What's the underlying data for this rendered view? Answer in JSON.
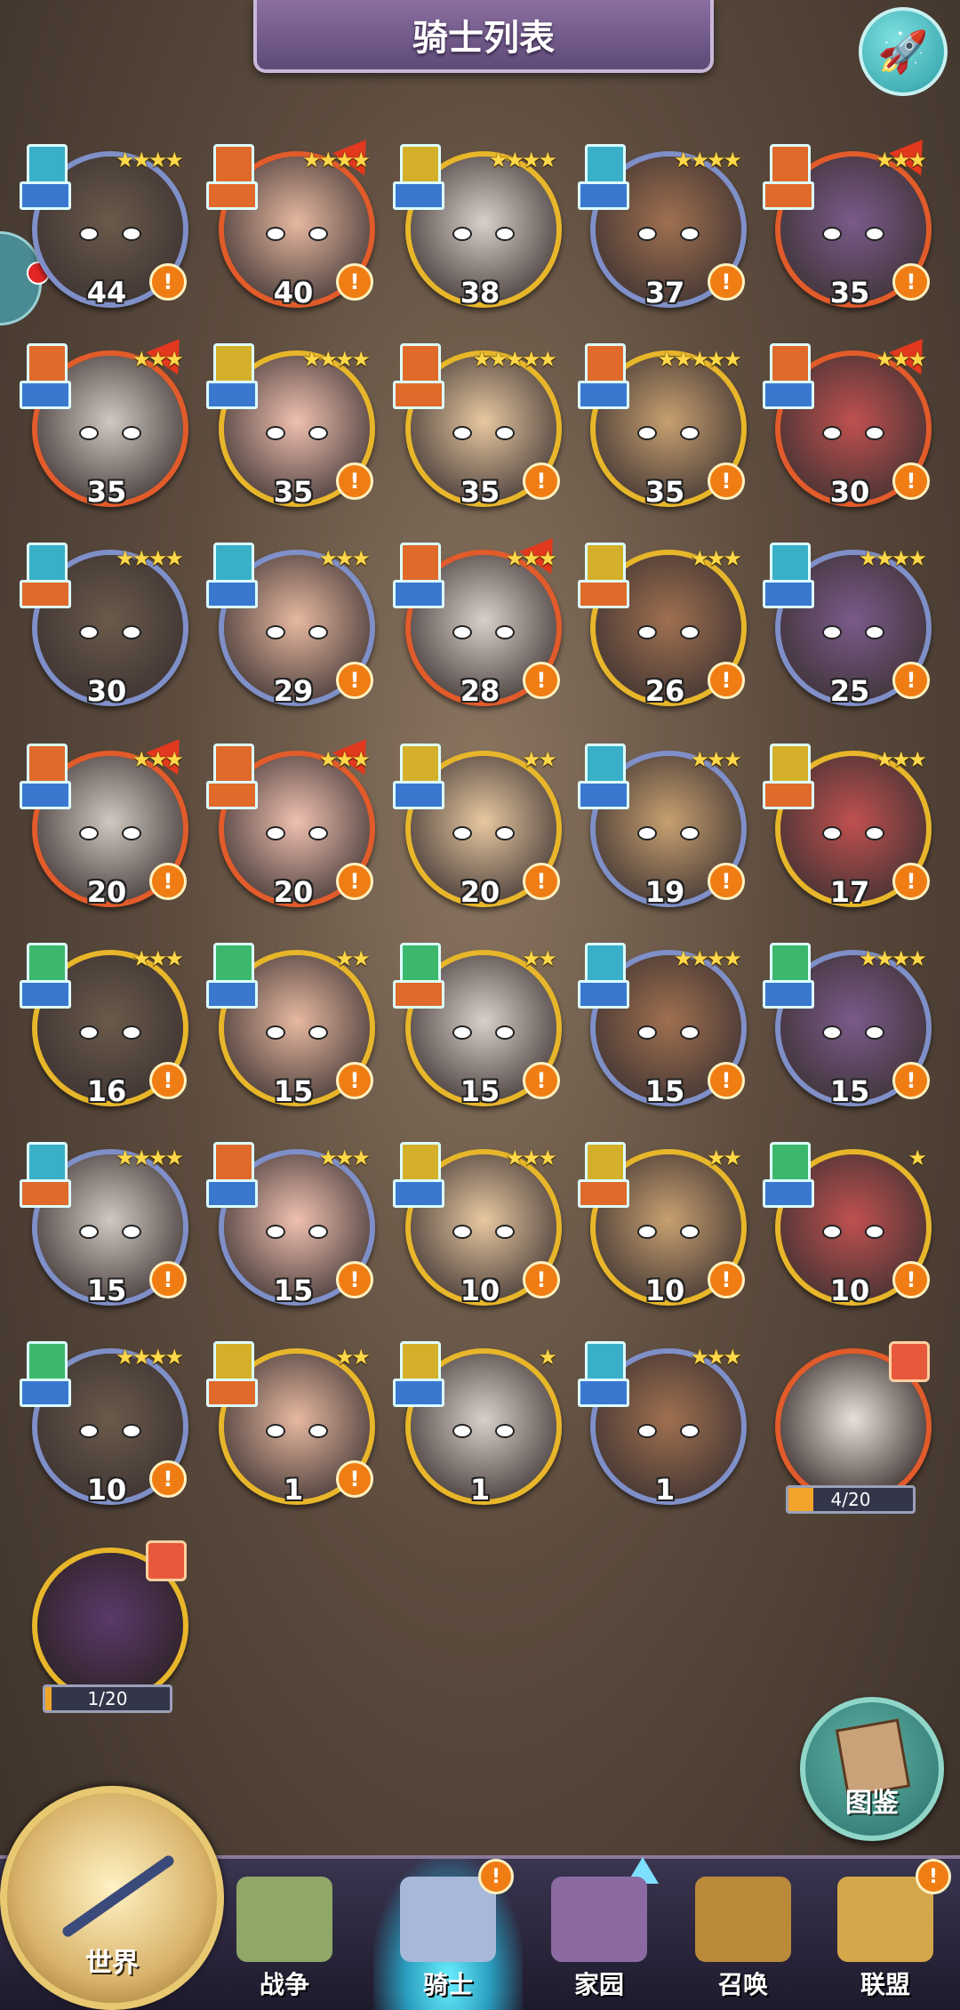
{
  "header": {
    "title": "骑士列表"
  },
  "knights": [
    {
      "level": "44",
      "stars": "★★★★",
      "rarity": "blue",
      "class": "cyan",
      "arrow": false,
      "alert": true
    },
    {
      "level": "40",
      "stars": "★★★★",
      "rarity": "red",
      "class": "orange",
      "arrow": true,
      "alert": true
    },
    {
      "level": "38",
      "stars": "★★★★",
      "rarity": "gold",
      "class": "yellow",
      "arrow": false,
      "alert": false
    },
    {
      "level": "37",
      "stars": "★★★★",
      "rarity": "blue",
      "class": "cyan",
      "arrow": false,
      "alert": true
    },
    {
      "level": "35",
      "stars": "★★★",
      "rarity": "red",
      "class": "orange",
      "arrow": true,
      "alert": true
    },
    {
      "level": "35",
      "stars": "★★★",
      "rarity": "red",
      "class": "orange",
      "arrow": true,
      "alert": false
    },
    {
      "level": "35",
      "stars": "★★★★",
      "rarity": "gold",
      "class": "yellow",
      "arrow": false,
      "alert": true
    },
    {
      "level": "35",
      "stars": "★★★★★",
      "rarity": "gold",
      "class": "orange",
      "arrow": false,
      "alert": true
    },
    {
      "level": "35",
      "stars": "★★★★★",
      "rarity": "gold",
      "class": "orange",
      "arrow": false,
      "alert": true
    },
    {
      "level": "30",
      "stars": "★★★",
      "rarity": "red",
      "class": "orange",
      "arrow": true,
      "alert": true
    },
    {
      "level": "30",
      "stars": "★★★★",
      "rarity": "blue",
      "class": "cyan",
      "arrow": false,
      "alert": false
    },
    {
      "level": "29",
      "stars": "★★★",
      "rarity": "blue",
      "class": "cyan",
      "arrow": false,
      "alert": true
    },
    {
      "level": "28",
      "stars": "★★★",
      "rarity": "red",
      "class": "orange",
      "arrow": true,
      "alert": true
    },
    {
      "level": "26",
      "stars": "★★★",
      "rarity": "gold",
      "class": "yellow",
      "arrow": false,
      "alert": true
    },
    {
      "level": "25",
      "stars": "★★★★",
      "rarity": "blue",
      "class": "cyan",
      "arrow": false,
      "alert": true
    },
    {
      "level": "20",
      "stars": "★★★",
      "rarity": "red",
      "class": "orange",
      "arrow": true,
      "alert": true
    },
    {
      "level": "20",
      "stars": "★★★",
      "rarity": "red",
      "class": "orange",
      "arrow": true,
      "alert": true
    },
    {
      "level": "20",
      "stars": "★★",
      "rarity": "gold",
      "class": "yellow",
      "arrow": false,
      "alert": true
    },
    {
      "level": "19",
      "stars": "★★★",
      "rarity": "blue",
      "class": "cyan",
      "arrow": false,
      "alert": true
    },
    {
      "level": "17",
      "stars": "★★★",
      "rarity": "gold",
      "class": "yellow",
      "arrow": false,
      "alert": true
    },
    {
      "level": "16",
      "stars": "★★★",
      "rarity": "gold",
      "class": "green",
      "arrow": false,
      "alert": true
    },
    {
      "level": "15",
      "stars": "★★",
      "rarity": "gold",
      "class": "green",
      "arrow": false,
      "alert": true
    },
    {
      "level": "15",
      "stars": "★★",
      "rarity": "gold",
      "class": "green",
      "arrow": false,
      "alert": true
    },
    {
      "level": "15",
      "stars": "★★★★",
      "rarity": "blue",
      "class": "cyan",
      "arrow": false,
      "alert": true
    },
    {
      "level": "15",
      "stars": "★★★★",
      "rarity": "blue",
      "class": "green",
      "arrow": false,
      "alert": true
    },
    {
      "level": "15",
      "stars": "★★★★",
      "rarity": "blue",
      "class": "cyan",
      "arrow": false,
      "alert": true
    },
    {
      "level": "15",
      "stars": "★★★",
      "rarity": "blue",
      "class": "orange",
      "arrow": false,
      "alert": true
    },
    {
      "level": "10",
      "stars": "★★★",
      "rarity": "gold",
      "class": "yellow",
      "arrow": false,
      "alert": true
    },
    {
      "level": "10",
      "stars": "★★",
      "rarity": "gold",
      "class": "yellow",
      "arrow": false,
      "alert": true
    },
    {
      "level": "10",
      "stars": "★",
      "rarity": "gold",
      "class": "green",
      "arrow": false,
      "alert": true
    },
    {
      "level": "10",
      "stars": "★★★★",
      "rarity": "blue",
      "class": "green",
      "arrow": false,
      "alert": true
    },
    {
      "level": "1",
      "stars": "★★",
      "rarity": "gold",
      "class": "yellow",
      "arrow": false,
      "alert": true
    },
    {
      "level": "1",
      "stars": "★",
      "rarity": "gold",
      "class": "yellow",
      "arrow": false,
      "alert": false
    },
    {
      "level": "1",
      "stars": "★★★",
      "rarity": "blue",
      "class": "cyan",
      "arrow": false,
      "alert": false
    }
  ],
  "fragments": [
    {
      "progress": "4/20",
      "fill": 0.2
    },
    {
      "progress": "1/20",
      "fill": 0.05
    }
  ],
  "codex": {
    "label": "图鉴"
  },
  "alert_glyph": "!",
  "nav": {
    "world": "世界",
    "items": [
      {
        "label": "战争",
        "badge": ""
      },
      {
        "label": "骑士",
        "badge": "!"
      },
      {
        "label": "家园",
        "badge": ""
      },
      {
        "label": "召唤",
        "badge": ""
      },
      {
        "label": "联盟",
        "badge": "!"
      }
    ]
  }
}
